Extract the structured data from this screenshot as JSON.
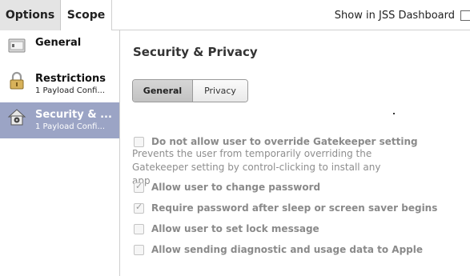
{
  "tabs": {
    "options": "Options",
    "scope": "Scope"
  },
  "jss_dashboard": {
    "label": "Show in JSS Dashboard",
    "checked": false
  },
  "sidebar": {
    "items": [
      {
        "title": "General",
        "subtitle": "",
        "icon": "general-icon",
        "active": false
      },
      {
        "title": "Restrictions",
        "subtitle": "1 Payload Confi...",
        "icon": "padlock-icon",
        "active": false
      },
      {
        "title": "Security & ...",
        "subtitle": "1 Payload Confi...",
        "icon": "security-house-icon",
        "active": true
      }
    ]
  },
  "main": {
    "title": "Security & Privacy",
    "segments": {
      "general": "General",
      "privacy": "Privacy",
      "selected": "General"
    },
    "options": [
      {
        "label": "Do not allow user to override Gatekeeper setting",
        "checked": false,
        "enabled": false
      },
      {
        "label": "Allow user to change password",
        "checked": true,
        "enabled": false
      },
      {
        "label": "Require password after sleep or screen saver begins",
        "checked": true,
        "enabled": false
      },
      {
        "label": "Allow user to set lock message",
        "checked": false,
        "enabled": false
      },
      {
        "label": "Allow sending diagnostic and usage data to Apple",
        "checked": false,
        "enabled": false
      }
    ],
    "gatekeeper_description": "Prevents the user from temporarily overriding the Gatekeeper setting by control-clicking to install any app"
  },
  "colors": {
    "active_sidebar": "#9ba4c5",
    "disabled_text": "#8a8a8a"
  }
}
